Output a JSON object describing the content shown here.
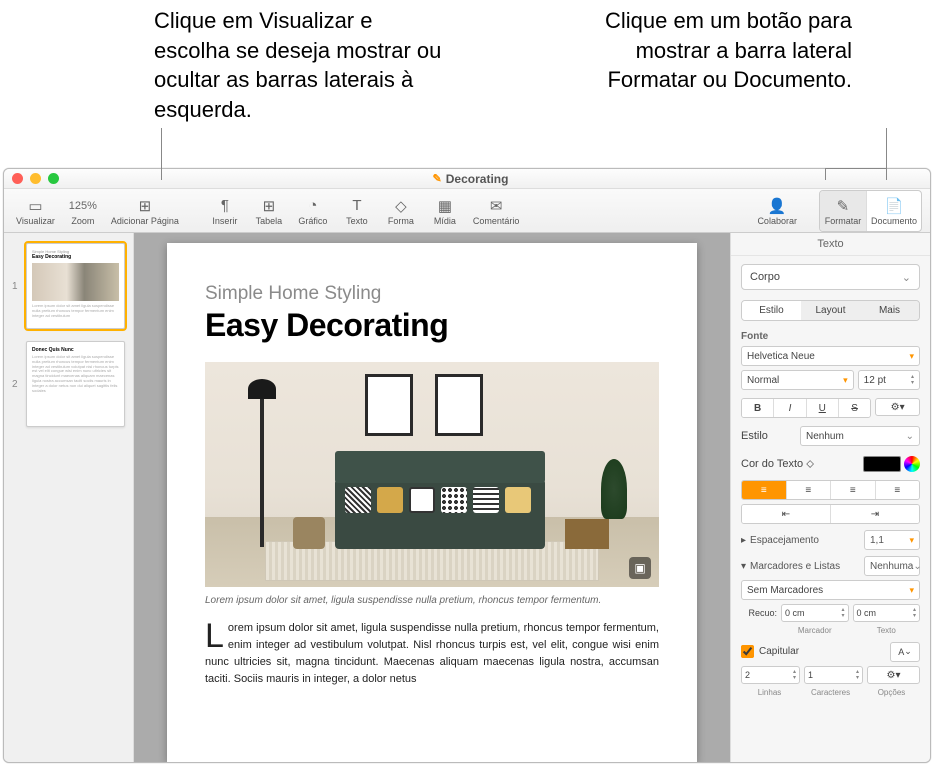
{
  "callouts": {
    "left": "Clique em Visualizar e escolha se deseja mostrar ou ocultar as barras laterais à esquerda.",
    "right": "Clique em um botão para mostrar a barra lateral Formatar ou Documento."
  },
  "window": {
    "title": "Decorating"
  },
  "toolbar": {
    "view": "Visualizar",
    "zoom": "Zoom",
    "zoom_value": "125%",
    "add_page": "Adicionar Página",
    "insert": "Inserir",
    "table": "Tabela",
    "chart": "Gráfico",
    "text": "Texto",
    "shape": "Forma",
    "media": "Mídia",
    "comment": "Comentário",
    "collaborate": "Colaborar",
    "format": "Formatar",
    "document": "Documento"
  },
  "thumbs": {
    "p1": "1",
    "p2": "2"
  },
  "page": {
    "subtitle": "Simple Home Styling",
    "headline": "Easy Decorating",
    "caption": "Lorem ipsum dolor sit amet, ligula suspendisse nulla pretium, rhoncus tempor fermentum.",
    "dropcap": "L",
    "body": "orem ipsum dolor sit amet, ligula suspendisse nulla pretium, rhoncus tempor fermentum, enim integer ad vestibulum volutpat. Nisl rhoncus turpis est, vel elit, congue wisi enim nunc ultricies sit, magna tincidunt. Maecenas aliquam maecenas ligula nostra, accumsan taciti. Sociis mauris in integer, a dolor netus"
  },
  "inspector": {
    "title": "Texto",
    "paragraph_style": "Corpo",
    "tabs": {
      "style": "Estilo",
      "layout": "Layout",
      "more": "Mais"
    },
    "font_label": "Fonte",
    "font_name": "Helvetica Neue",
    "font_weight": "Normal",
    "font_size": "12 pt",
    "bold": "B",
    "italic": "I",
    "underline": "U",
    "strike": "S",
    "char_style_label": "Estilo",
    "char_style_value": "Nenhum",
    "text_color_label": "Cor do Texto",
    "spacing_label": "Espacejamento",
    "spacing_value": "1,1",
    "bullets_label": "Marcadores e Listas",
    "bullets_value": "Nenhuma",
    "bullets_style": "Sem Marcadores",
    "indent_label": "Recuo:",
    "indent_marker": "0 cm",
    "indent_text": "0 cm",
    "indent_marker_label": "Marcador",
    "indent_text_label": "Texto",
    "dropcap_label": "Capitular",
    "dropcap_preview": "A",
    "lines": "2",
    "lines_label": "Linhas",
    "chars": "1",
    "chars_label": "Caracteres",
    "options_label": "Opções"
  }
}
